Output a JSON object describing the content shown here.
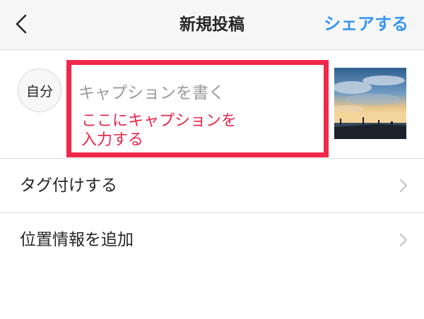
{
  "header": {
    "title": "新規投稿",
    "share_label": "シェアする",
    "back_icon": "chevron-left-icon"
  },
  "caption": {
    "avatar_text": "自分",
    "placeholder": "キャプションを書く",
    "hint_line1": "ここにキャプションを",
    "hint_line2": "入力する",
    "highlight_color": "#f0284a"
  },
  "list": {
    "items": [
      {
        "label": "タグ付けする",
        "icon": "chevron-right-icon"
      },
      {
        "label": "位置情報を追加",
        "icon": "chevron-right-icon"
      }
    ]
  },
  "colors": {
    "accent": "#3897f0",
    "hint_text": "#e8274a",
    "divider": "#dbdbdb"
  }
}
